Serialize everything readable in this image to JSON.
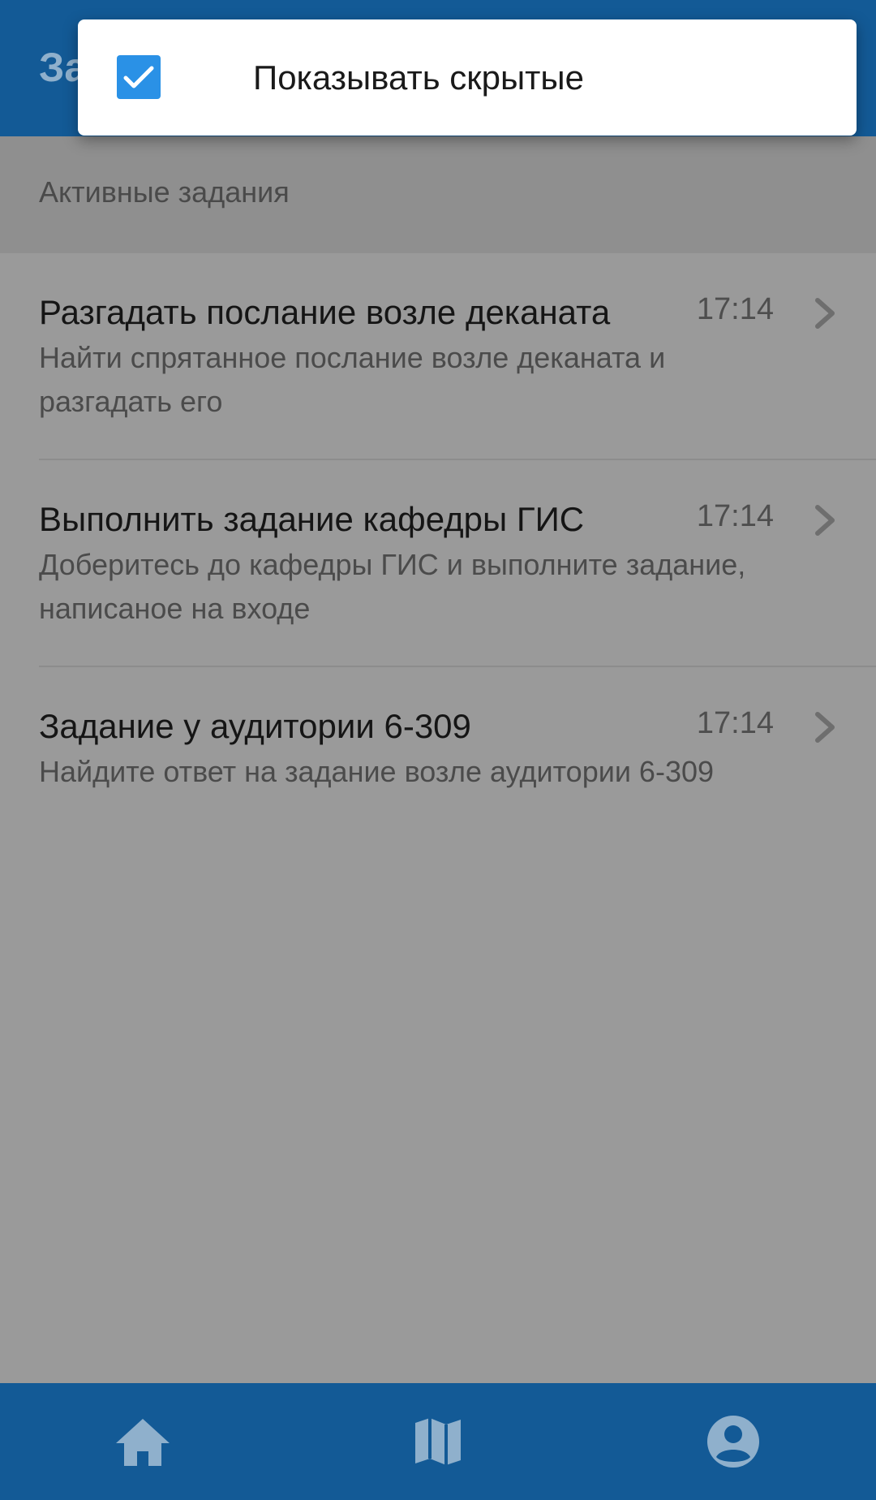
{
  "app_bar": {
    "title": "За"
  },
  "section": {
    "title": "Активные задания"
  },
  "tasks": [
    {
      "title": "Разгадать послание возле деканата",
      "description": "Найти спрятанное послание возле деканата и разгадать его",
      "time": "17:14"
    },
    {
      "title": "Выполнить задание кафедры ГИС",
      "description": "Доберитесь до кафедры ГИС и выполните задание, написаное на входе",
      "time": "17:14"
    },
    {
      "title": "Задание у аудитории 6-309",
      "description": "Найдите ответ на задание возле аудитории 6-309",
      "time": "17:14"
    }
  ],
  "popup": {
    "checkbox_checked": true,
    "label": "Показывать скрытые"
  },
  "bottom_nav": {
    "items": [
      {
        "icon": "home-icon"
      },
      {
        "icon": "map-icon"
      },
      {
        "icon": "account-circle-icon"
      }
    ]
  },
  "colors": {
    "primary": "#135a96",
    "checkbox": "#2a91e6",
    "scrim_background": "#9a9a9a"
  }
}
